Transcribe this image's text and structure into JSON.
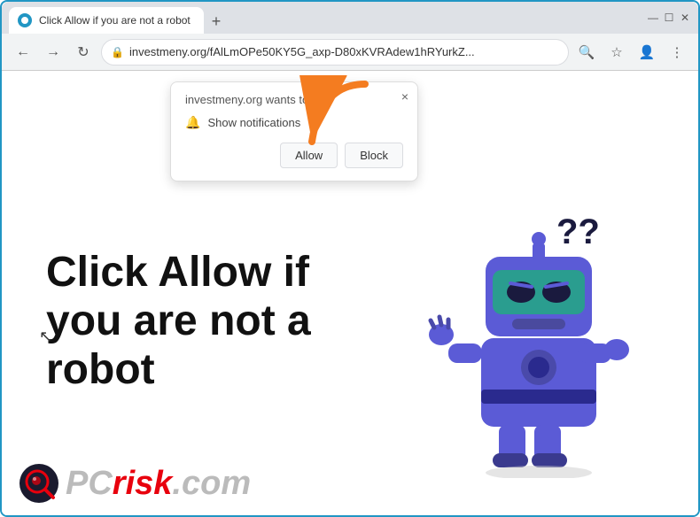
{
  "browser": {
    "tab": {
      "title": "Click Allow if you are not a robot",
      "favicon": "globe-icon"
    },
    "new_tab_label": "+",
    "window_controls": {
      "minimize": "—",
      "maximize": "☐",
      "close": "✕"
    },
    "address_bar": {
      "url": "investmeny.org/fAlLmOPe50KY5G_axp-D80xKVRAdew1hRYurkZ...",
      "lock_icon": "🔒"
    },
    "nav": {
      "back": "←",
      "forward": "→",
      "refresh": "↻"
    }
  },
  "notification_popup": {
    "title": "investmeny.org wants to",
    "close_label": "×",
    "notification_text": "Show notifications",
    "allow_label": "Allow",
    "block_label": "Block"
  },
  "page": {
    "main_text": "Click Allow if you are not a robot"
  },
  "watermark": {
    "brand": "PC",
    "risk": "risk",
    "dot_com": ".com"
  },
  "colors": {
    "accent_blue": "#2196c4",
    "orange_arrow": "#f47c20",
    "robot_blue": "#5b5bd6",
    "risk_red": "#e8000d"
  }
}
